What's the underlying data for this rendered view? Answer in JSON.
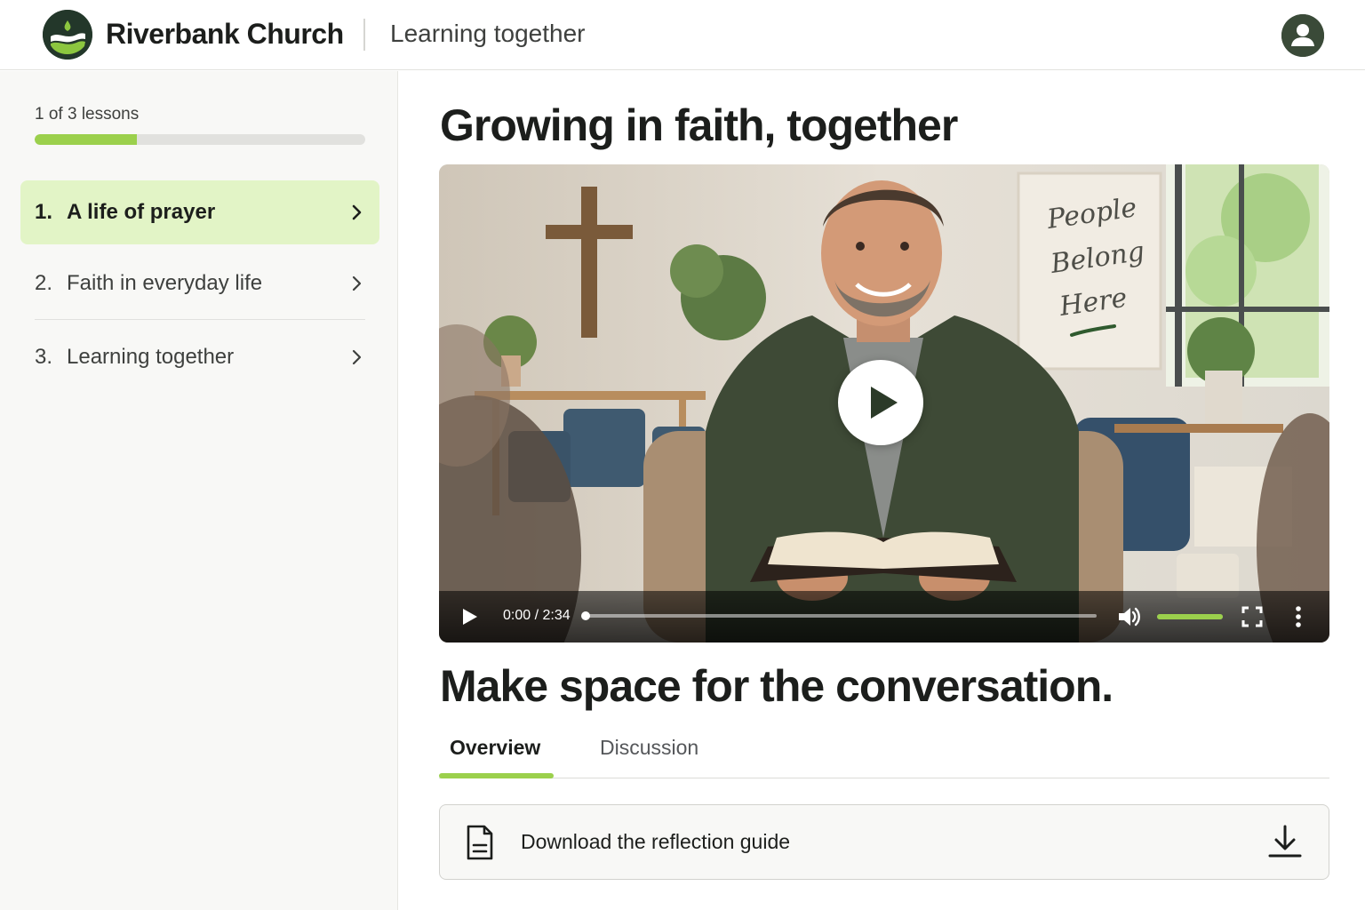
{
  "header": {
    "brand": "Riverbank Church",
    "subtitle": "Learning together",
    "logo_icon": "riverbank-logo-icon",
    "avatar_icon": "user-avatar-icon"
  },
  "sidebar": {
    "progress_text": "1 of 3 lessons",
    "progress_fraction": 0.31,
    "lessons": [
      {
        "number": "1.",
        "title": "A life of prayer",
        "active": true
      },
      {
        "number": "2.",
        "title": "Faith in everyday life",
        "active": false
      },
      {
        "number": "3.",
        "title": "Learning together",
        "active": false
      }
    ]
  },
  "main": {
    "title": "Growing in faith, together",
    "video": {
      "time": "0:00 / 2:34",
      "position_fraction": 0,
      "volume_fraction": 1,
      "sign_text": [
        "People",
        "Belong",
        "Here"
      ]
    },
    "section_title": "Make space for the conversation.",
    "tabs": [
      {
        "label": "Overview",
        "active": true
      },
      {
        "label": "Discussion",
        "active": false
      }
    ],
    "download_label": "Download the reflection guide"
  },
  "colors": {
    "accent": "#9bd04c",
    "active_lesson_bg": "#e2f4c6",
    "brand_dark": "#23372a"
  }
}
